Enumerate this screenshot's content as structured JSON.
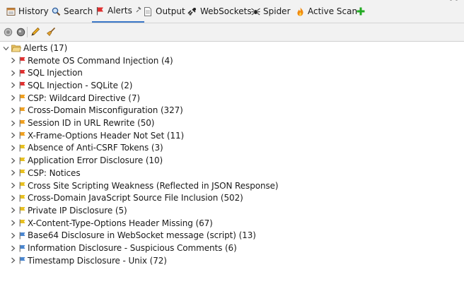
{
  "tabs": [
    {
      "label": "History",
      "icon": "history-icon"
    },
    {
      "label": "Search",
      "icon": "search-icon"
    },
    {
      "label": "Alerts",
      "icon": "flag-icon",
      "pin": "📌",
      "active": true
    },
    {
      "label": "Output",
      "icon": "document-icon"
    },
    {
      "label": "WebSockets",
      "icon": "websocket-icon"
    },
    {
      "label": "Spider",
      "icon": "spider-icon"
    },
    {
      "label": "Active Scan",
      "icon": "flame-icon"
    }
  ],
  "tab_add_icon": "plus-icon",
  "toolbar": {
    "buttons": [
      "circle-gray-icon",
      "circle-dark-icon",
      "pencil-icon",
      "broom-icon"
    ]
  },
  "tree": {
    "root": {
      "label": "Alerts (17)",
      "icon": "folder-open-icon",
      "expanded": true
    },
    "items": [
      {
        "label": "Remote OS Command Injection (4)",
        "risk": "high"
      },
      {
        "label": "SQL Injection",
        "risk": "high"
      },
      {
        "label": "SQL Injection - SQLite (2)",
        "risk": "high"
      },
      {
        "label": "CSP: Wildcard Directive (7)",
        "risk": "medium"
      },
      {
        "label": "Cross-Domain Misconfiguration (327)",
        "risk": "medium"
      },
      {
        "label": "Session ID in URL Rewrite (50)",
        "risk": "medium"
      },
      {
        "label": "X-Frame-Options Header Not Set (11)",
        "risk": "medium"
      },
      {
        "label": "Absence of Anti-CSRF Tokens (3)",
        "risk": "low"
      },
      {
        "label": "Application Error Disclosure (10)",
        "risk": "low"
      },
      {
        "label": "CSP: Notices",
        "risk": "low"
      },
      {
        "label": "Cross Site Scripting Weakness (Reflected in JSON Response)",
        "risk": "low"
      },
      {
        "label": "Cross-Domain JavaScript Source File Inclusion (502)",
        "risk": "low"
      },
      {
        "label": "Private IP Disclosure (5)",
        "risk": "low"
      },
      {
        "label": "X-Content-Type-Options Header Missing (67)",
        "risk": "low"
      },
      {
        "label": "Base64 Disclosure in WebSocket message (script) (13)",
        "risk": "info"
      },
      {
        "label": "Information Disclosure - Suspicious Comments (6)",
        "risk": "info"
      },
      {
        "label": "Timestamp Disclosure - Unix (72)",
        "risk": "info"
      }
    ]
  },
  "colors": {
    "high": "#e03030",
    "medium": "#f0a020",
    "low": "#e8c020",
    "info": "#4a86d0",
    "accent": "#3c78c8",
    "folder": "#e8c060",
    "add": "#22aa22"
  }
}
